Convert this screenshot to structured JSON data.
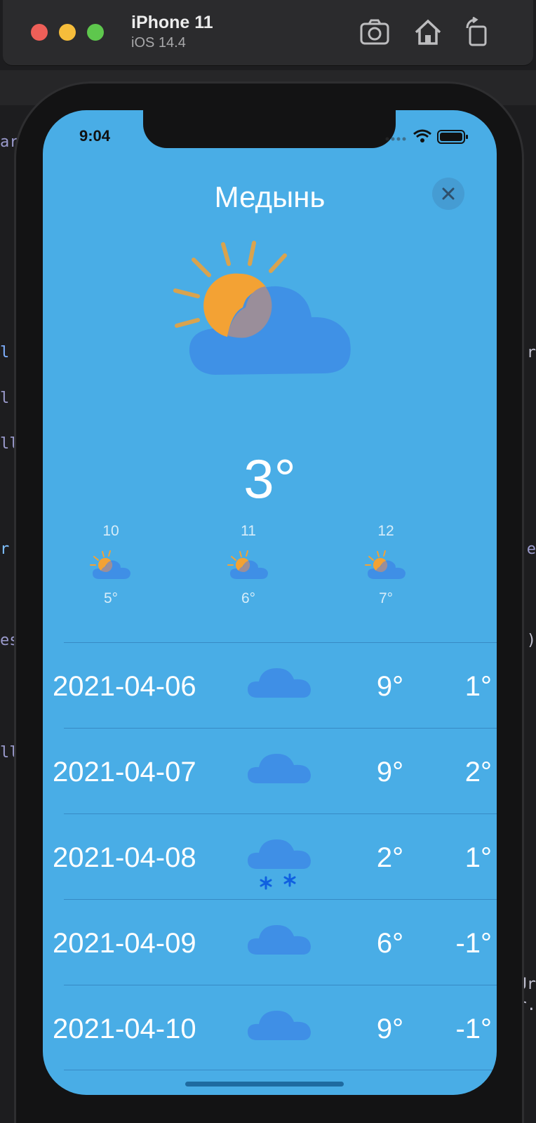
{
  "titlebar": {
    "device_name": "iPhone 11",
    "os_version": "iOS 14.4",
    "icons": [
      "screenshot-icon",
      "home-icon",
      "rotate-icon"
    ]
  },
  "status_bar": {
    "time": "9:04"
  },
  "weather": {
    "city": "Медынь",
    "current_temp": "3°",
    "current_icon": "sun-behind-cloud-icon",
    "hourly": [
      {
        "time": "10",
        "temp": "5°",
        "icon": "sun-behind-cloud-icon"
      },
      {
        "time": "11",
        "temp": "6°",
        "icon": "sun-behind-cloud-icon"
      },
      {
        "time": "12",
        "temp": "7°",
        "icon": "sun-behind-cloud-icon"
      }
    ],
    "daily": [
      {
        "date": "2021-04-06",
        "max": "9°",
        "min": "1°",
        "icon": "cloud-icon"
      },
      {
        "date": "2021-04-07",
        "max": "9°",
        "min": "2°",
        "icon": "cloud-icon"
      },
      {
        "date": "2021-04-08",
        "max": "2°",
        "min": "1°",
        "icon": "cloud-snow-icon"
      },
      {
        "date": "2021-04-09",
        "max": "6°",
        "min": "-1°",
        "icon": "cloud-icon"
      },
      {
        "date": "2021-04-10",
        "max": "9°",
        "min": "-1°",
        "icon": "cloud-icon"
      }
    ]
  },
  "colors": {
    "screen_background": "#49ade6",
    "cloud": "#3f8fe6",
    "sun": "#f3a234",
    "snow": "#1060e0"
  }
}
